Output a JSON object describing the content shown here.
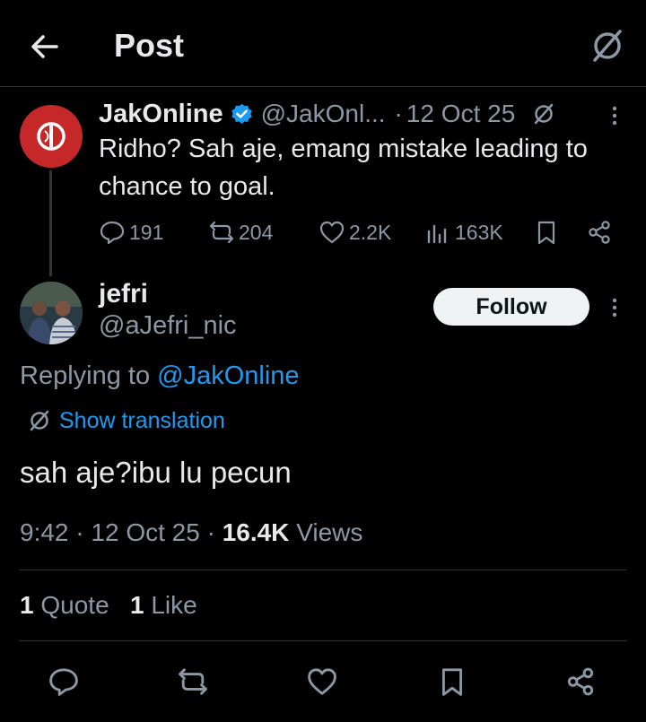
{
  "header": {
    "title": "Post",
    "back_icon": "arrow-left-icon",
    "grok_icon": "grok-icon"
  },
  "parent_post": {
    "name": "JakOnline",
    "handle": "@JakOnl...",
    "date": "12 Oct 25",
    "separator": "·",
    "text": "Ridho? Sah aje, emang mistake leading to chance to goal.",
    "verified": true,
    "avatar_color": "#c62828",
    "actions": {
      "replies": "191",
      "reposts": "204",
      "likes": "2.2K",
      "views": "163K"
    }
  },
  "post": {
    "name": "jefri",
    "handle": "@aJefri_nic",
    "follow_label": "Follow",
    "replying_prefix": "Replying to",
    "replying_mention": "@JakOnline",
    "translate_label": "Show translation",
    "text": "sah aje?ibu lu pecun",
    "time": "9:42",
    "date": "12 Oct 25",
    "separator": "·",
    "views_count": "16.4K",
    "views_label": "Views",
    "quote_count": "1",
    "quote_label": "Quote",
    "like_count": "1",
    "like_label": "Like"
  },
  "colors": {
    "background": "#000000",
    "text_primary": "#e7e9ea",
    "text_secondary": "#8b98a5",
    "accent": "#1d9bf0",
    "divider": "#2f3336",
    "follow_bg": "#eff3f4"
  }
}
